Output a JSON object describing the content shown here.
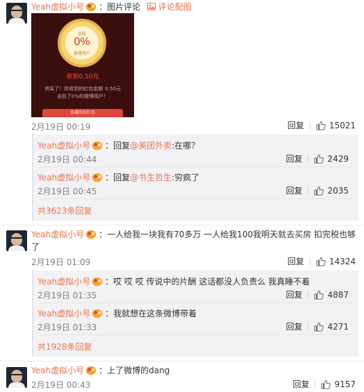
{
  "colors": {
    "accent": "#eb7350",
    "text": "#333333",
    "muted": "#808080",
    "reply_bg": "#f2f2f5"
  },
  "icons": {
    "like": "thumbs-up-icon",
    "vip": "vip-crown-icon",
    "picture": "picture-icon"
  },
  "comments": [
    {
      "user": "Yeah虚拟小号",
      "prefix": "：",
      "tag_pic": "图片评论",
      "tag_pic_link": "评论配图",
      "image": {
        "top_text": "击败",
        "percent": "0%",
        "bottom_text": "微博用户",
        "amount": "收到0.50元",
        "line1": "帅呆了！你收到的红包金额",
        "line1_tail": "0.50元",
        "line2": "击败了0%的微博用户！",
        "button": "炫耀我的红包"
      },
      "time": "2月19日 00:19",
      "reply": "回复",
      "likes": "15021",
      "replies": [
        {
          "user": "Yeah虚拟小号",
          "prefix": "：回复",
          "mention": "@美团外卖",
          "text": ":在哪？",
          "time": "2月19日 00:44",
          "reply": "回复",
          "likes": "2429"
        },
        {
          "user": "Yeah虚拟小号",
          "prefix": "：回复",
          "mention": "@书生哲生",
          "text": ":穷疯了",
          "time": "2月19日 00:45",
          "reply": "回复",
          "likes": "2035"
        }
      ],
      "more": "共3623条回复"
    },
    {
      "user": "Yeah虚拟小号",
      "prefix": "：",
      "text_line1": "一人给我一块我有70多万 一人给我100我明天就去买房 扣完税也够",
      "text_line2": "了",
      "time": "2月19日 01:09",
      "reply": "回复",
      "likes": "14324",
      "replies": [
        {
          "user": "Yeah虚拟小号",
          "prefix": "：",
          "text": "哎 哎 哎 传说中的片酬 这话都没人负责么 我真睡不着",
          "time": "2月19日 01:35",
          "reply": "回复",
          "likes": "4887"
        },
        {
          "user": "Yeah虚拟小号",
          "prefix": "：",
          "text": "我就想在这条微博带着",
          "time": "2月19日 01:33",
          "reply": "回复",
          "likes": "4271"
        }
      ],
      "more": "共1928条回复"
    },
    {
      "user": "Yeah虚拟小号",
      "prefix": "：",
      "text": "上了微博的dang",
      "time": "2月19日 00:43",
      "reply": "回复",
      "likes": "9157"
    }
  ]
}
